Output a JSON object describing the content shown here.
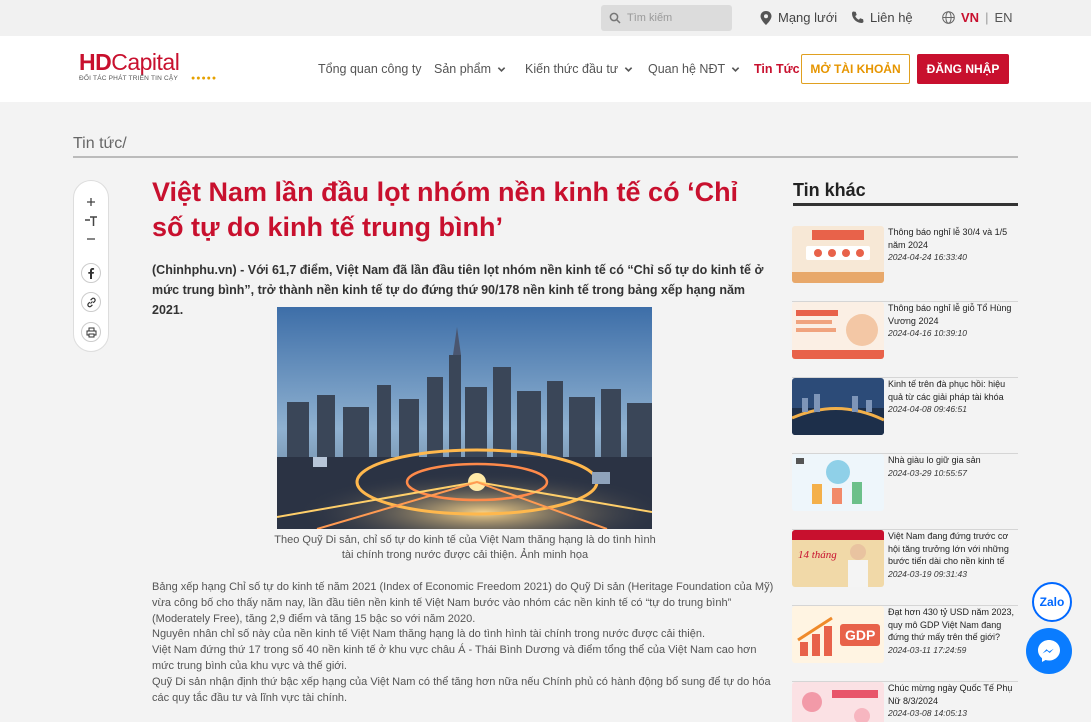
{
  "topbar": {
    "search_placeholder": "Tìm kiếm",
    "network": "Mạng lưới",
    "contact": "Liên hệ",
    "lang_vn": "VN",
    "lang_en": "EN"
  },
  "brand": {
    "hd": "HD",
    "capital": "Capital",
    "tagline": "ĐỐI TÁC PHÁT TRIỂN TIN CẬY"
  },
  "nav": {
    "overview": "Tổng quan công ty",
    "products": "Sản phẩm",
    "knowledge": "Kiến thức đầu tư",
    "ir": "Quan hệ NĐT",
    "news": "Tin Tức",
    "open_account": "MỞ TÀI KHOẢN",
    "login": "ĐĂNG NHẬP"
  },
  "breadcrumb": "Tin tức/",
  "article": {
    "title": "Việt Nam lần đầu lọt nhóm nền kinh tế có ‘Chỉ số tự do kinh tế trung bình’",
    "lead": "(Chinhphu.vn) - Với 61,7 điểm, Việt Nam đã lần đầu tiên lọt nhóm nền kinh tế có “Chỉ số tự do kinh tế ở mức trung bình”, trở thành nền kinh tế tự do đứng thứ 90/178 nền kinh tế trong bảng xếp hạng năm 2021.",
    "caption": "Theo Quỹ Di sản, chỉ số tự do kinh tế của Việt Nam thăng hạng là do tình hình tài chính trong nước được cải thiện. Ảnh minh họa",
    "paragraphs": [
      "Bảng xếp hạng Chỉ số tự do kinh tế năm 2021 (Index of Economic Freedom 2021) do Quỹ Di sản (Heritage Foundation của Mỹ) vừa công bố cho thấy năm nay, lần đầu tiên nền kinh tế Việt Nam bước vào nhóm các nền kinh tế có “tự do trung bình” (Moderately Free), tăng 2,9 điểm và tăng 15 bậc so với năm 2020.",
      "Nguyên nhân chỉ số này của nền kinh tế Việt Nam thăng hạng là do tình hình tài chính trong nước được cải thiện.",
      "Việt Nam đứng thứ 17 trong số 40 nền kinh tế ở khu vực châu Á - Thái Bình Dương và điểm tổng thể của Việt Nam cao hơn mức trung bình của khu vực và thế giới.",
      "Quỹ Di sản nhận định thứ bậc xếp hạng của Việt Nam có thể tăng hơn nữa nếu Chính phủ có hành động bổ sung để tự do hóa các quy tắc đầu tư và lĩnh vực tài chính."
    ]
  },
  "sidebar": {
    "title": "Tin khác",
    "items": [
      {
        "title": "Thông báo nghỉ lễ 30/4 và 1/5 năm 2024",
        "date": "2024-04-24 16:33:40"
      },
      {
        "title": "Thông báo nghỉ lễ giỗ Tổ Hùng Vương 2024",
        "date": "2024-04-16 10:39:10"
      },
      {
        "title": "Kinh tế trên đà phục hồi: hiệu quả từ các giải pháp tài khóa",
        "date": "2024-04-08 09:46:51"
      },
      {
        "title": "Nhà giàu lo giữ gia sản",
        "date": "2024-03-29 10:55:57"
      },
      {
        "title": "Việt Nam đang đứng trước cơ hội tăng trưởng lớn với những bước tiến dài cho nền kinh tế",
        "date": "2024-03-19 09:31:43"
      },
      {
        "title": "Đạt hơn 430 tỷ USD năm 2023, quy mô GDP Việt Nam đang đứng thứ mấy trên thế giới?",
        "date": "2024-03-11 17:24:59"
      },
      {
        "title": "Chúc mừng ngày Quốc Tế Phụ Nữ 8/3/2024",
        "date": "2024-03-08 14:05:13"
      }
    ],
    "thumb_labels": {
      "banner": "14 tháng",
      "gdp": "GDP"
    }
  },
  "widgets": {
    "zalo": "Zalo"
  }
}
